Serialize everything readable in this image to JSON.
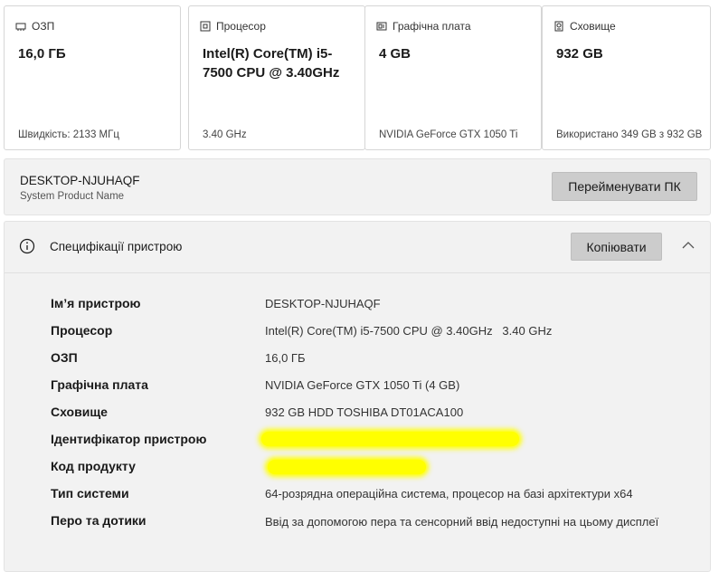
{
  "cards": [
    {
      "icon": "ram-icon",
      "title": "ОЗП",
      "value": "16,0 ГБ",
      "footer": "Швидкість: 2133 МГц"
    },
    {
      "icon": "cpu-icon",
      "title": "Процесор",
      "value": "Intel(R) Core(TM) i5-7500 CPU @ 3.40GHz",
      "footer": "3.40 GHz"
    },
    {
      "icon": "gpu-icon",
      "title": "Графічна плата",
      "value": "4 GB",
      "footer": "NVIDIA GeForce GTX 1050 Ti"
    },
    {
      "icon": "storage-icon",
      "title": "Сховище",
      "value": "932 GB",
      "footer": "Використано 349 GB з 932 GB"
    }
  ],
  "pc": {
    "name": "DESKTOP-NJUHAQF",
    "subtitle": "System Product Name",
    "rename_label": "Перейменувати ПК"
  },
  "specs": {
    "title": "Специфікації пристрою",
    "copy_label": "Копіювати",
    "rows": [
      {
        "label": "Ім’я пристрою",
        "value": "DESKTOP-NJUHAQF"
      },
      {
        "label": "Процесор",
        "value": "Intel(R) Core(TM) i5-7500 CPU @ 3.40GHz   3.40 GHz"
      },
      {
        "label": "ОЗП",
        "value": "16,0 ГБ"
      },
      {
        "label": "Графічна плата",
        "value": "NVIDIA GeForce GTX 1050 Ti (4 GB)"
      },
      {
        "label": "Сховище",
        "value": "932 GB HDD TOSHIBA DT01ACA100"
      },
      {
        "label": "Ідентифікатор пристрою",
        "value": ""
      },
      {
        "label": "Код продукту",
        "value": ""
      },
      {
        "label": "Тип системи",
        "value": "64-розрядна операційна система, процесор на базі архітектури x64"
      },
      {
        "label": "Перо та дотики",
        "value": "Ввід за допомогою пера та сенсорний ввід недоступні на цьому дисплеї"
      }
    ]
  },
  "colors": {
    "redaction": "#ffff00",
    "button_bg": "#cccccc",
    "panel_bg": "#f2f2f2"
  }
}
